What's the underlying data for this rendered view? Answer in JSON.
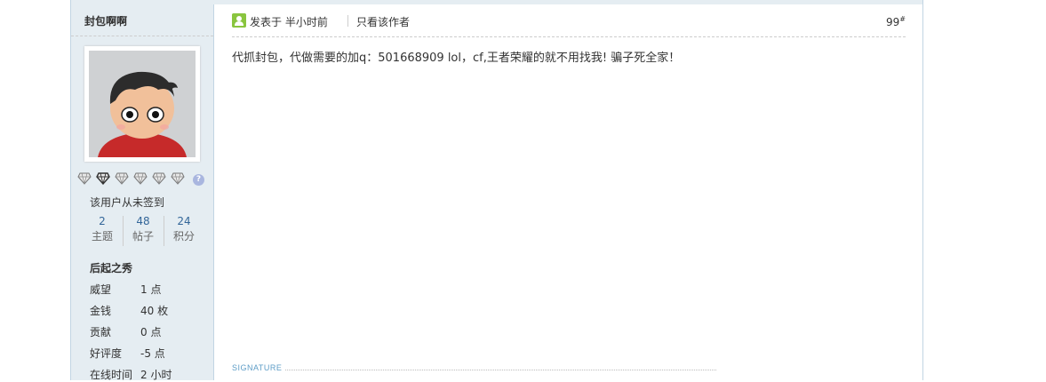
{
  "author": {
    "name": "封包啊啊",
    "signin_status": "该用户从未签到",
    "stats": [
      {
        "value": "2",
        "label": "主题"
      },
      {
        "value": "48",
        "label": "帖子"
      },
      {
        "value": "24",
        "label": "积分"
      }
    ],
    "rank": "后起之秀",
    "info": [
      {
        "key": "威望",
        "value": "1 点"
      },
      {
        "key": "金钱",
        "value": "40 枚"
      },
      {
        "key": "贡献",
        "value": "0 点"
      },
      {
        "key": "好评度",
        "value": "-5 点"
      },
      {
        "key": "在线时间",
        "value": "2 小时"
      }
    ],
    "medal_count": 6,
    "help_glyph": "?"
  },
  "post": {
    "posted_label": "发表于 半小时前",
    "author_only_label": "只看该作者",
    "floor": "99",
    "floor_mark": "#",
    "message": "代抓封包，代做需要的加q：501668909    lol，cf,王者荣耀的就不用找我!   骗子死全家！",
    "signature_label": "SIGNATURE"
  },
  "colors": {
    "border": "#c2d5e3",
    "sidebar_bg": "#e5edf2",
    "link_blue": "#336699",
    "online_green": "#8ac53f"
  }
}
